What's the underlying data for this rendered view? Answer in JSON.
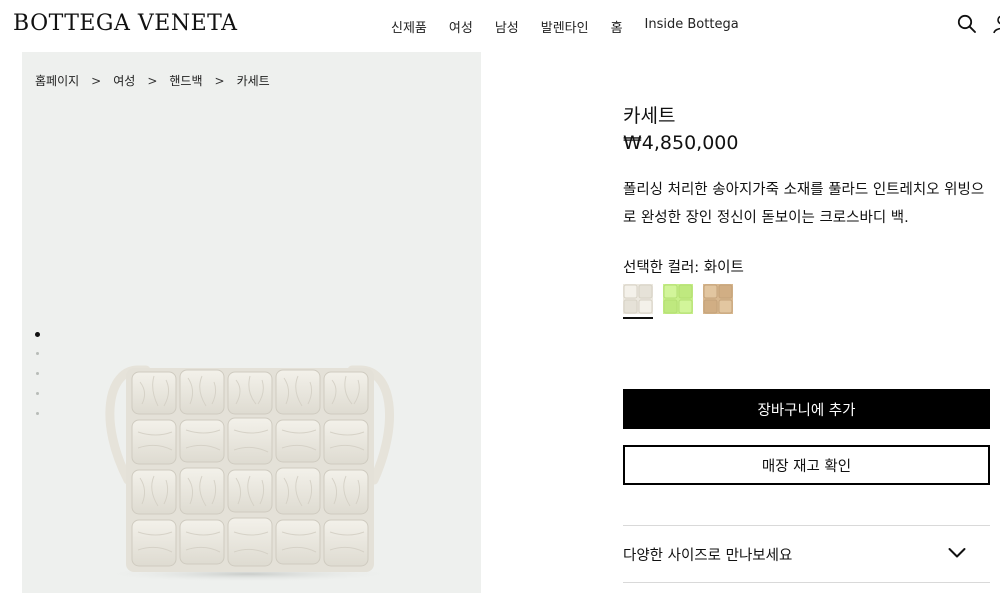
{
  "header": {
    "logo": "BOTTEGA VENETA",
    "nav": [
      "신제품",
      "여성",
      "남성",
      "발렌타인",
      "홈",
      "Inside Bottega"
    ],
    "search_icon": "search-icon",
    "account_icon": "account-icon"
  },
  "breadcrumb": [
    "홈페이지",
    "여성",
    "핸드백",
    "카세트"
  ],
  "breadcrumb_separator": ">",
  "gallery": {
    "image": "cassette-bag-white",
    "dots_total": 5,
    "active_index": 0
  },
  "product": {
    "name": "카세트",
    "price": "₩4,850,000",
    "description": "폴리싱 처리한 송아지가죽 소재를 풀라드 인트레치오 위빙으로 완성한 장인 정신이 돋보이는 크로스바디 백.",
    "color_label": "선택한 컬러: 화이트",
    "swatches": [
      {
        "name": "화이트",
        "color": "#ece8df",
        "selected": true
      },
      {
        "name": "라임",
        "color": "#c7ef8a",
        "selected": false
      },
      {
        "name": "베이지",
        "color": "#d8b88f",
        "selected": false
      }
    ]
  },
  "actions": {
    "add_to_cart": "장바구니에 추가",
    "check_store_stock": "매장 재고 확인"
  },
  "accordion": {
    "label": "다양한 사이즈로 만나보세요"
  },
  "colors": {
    "primary": "#000000",
    "panel_bg": "#eef0ee",
    "divider": "#d9d9d9"
  }
}
